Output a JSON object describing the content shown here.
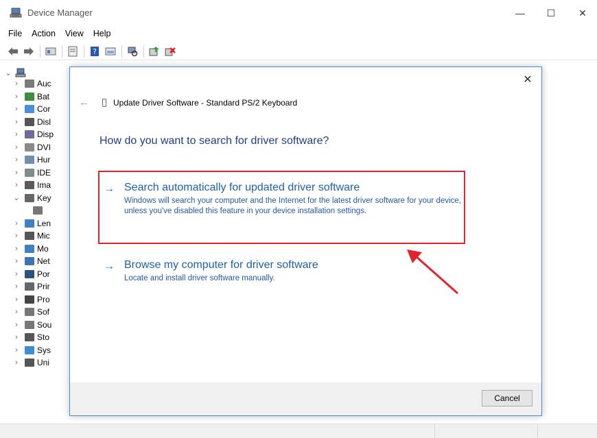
{
  "window": {
    "title": "Device Manager",
    "minimize": "—",
    "maximize": "☐",
    "close": "✕"
  },
  "menu": {
    "items": [
      "File",
      "Action",
      "View",
      "Help"
    ]
  },
  "toolbar": {
    "icons": [
      "back-icon",
      "forward-icon",
      "properties-icon",
      "show-hidden-icon",
      "help-icon",
      "view-icon",
      "scan-icon",
      "update-driver-icon",
      "uninstall-icon"
    ]
  },
  "tree": {
    "root_expander": "⌄",
    "items": [
      {
        "label": "Auc",
        "chev": "›",
        "icon_color": "#7a7a7a"
      },
      {
        "label": "Bat",
        "chev": "›",
        "icon_color": "#3c8f3c"
      },
      {
        "label": "Cor",
        "chev": "›",
        "icon_color": "#4a90d9"
      },
      {
        "label": "Disl",
        "chev": "›",
        "icon_color": "#555555"
      },
      {
        "label": "Disp",
        "chev": "›",
        "icon_color": "#6b6b9c"
      },
      {
        "label": "DVI",
        "chev": "›",
        "icon_color": "#8a8a8a"
      },
      {
        "label": "Hur",
        "chev": "›",
        "icon_color": "#6f8fb0"
      },
      {
        "label": "IDE",
        "chev": "›",
        "icon_color": "#7d8b8b"
      },
      {
        "label": "Ima",
        "chev": "›",
        "icon_color": "#5a5a5a"
      },
      {
        "label": "Key",
        "chev": "⌄",
        "icon_color": "#666666"
      },
      {
        "label": "",
        "chev": "",
        "icon_color": "#777777"
      },
      {
        "label": "Len",
        "chev": "›",
        "icon_color": "#3f7fc4"
      },
      {
        "label": "Mic",
        "chev": "›",
        "icon_color": "#555555"
      },
      {
        "label": "Mo",
        "chev": "›",
        "icon_color": "#3e7fc2"
      },
      {
        "label": "Net",
        "chev": "›",
        "icon_color": "#3d74b8"
      },
      {
        "label": "Por",
        "chev": "›",
        "icon_color": "#2c4f7c"
      },
      {
        "label": "Prir",
        "chev": "›",
        "icon_color": "#666666"
      },
      {
        "label": "Pro",
        "chev": "›",
        "icon_color": "#444444"
      },
      {
        "label": "Sof",
        "chev": "›",
        "icon_color": "#777777"
      },
      {
        "label": "Sou",
        "chev": "›",
        "icon_color": "#777777"
      },
      {
        "label": "Sto",
        "chev": "›",
        "icon_color": "#555555"
      },
      {
        "label": "Sys",
        "chev": "›",
        "icon_color": "#3f8fd0"
      },
      {
        "label": "Uni",
        "chev": "›",
        "icon_color": "#555555"
      }
    ]
  },
  "dialog": {
    "close": "✕",
    "back": "←",
    "title": "Update Driver Software - Standard PS/2 Keyboard",
    "heading": "How do you want to search for driver software?",
    "options": [
      {
        "arrow": "→",
        "title": "Search automatically for updated driver software",
        "description": "Windows will search your computer and the Internet for the latest driver software for your device, unless you've disabled this feature in your device installation settings."
      },
      {
        "arrow": "→",
        "title": "Browse my computer for driver software",
        "description": "Locate and install driver software manually."
      }
    ],
    "cancel": "Cancel"
  },
  "annotation": {
    "color": "#e32229"
  }
}
